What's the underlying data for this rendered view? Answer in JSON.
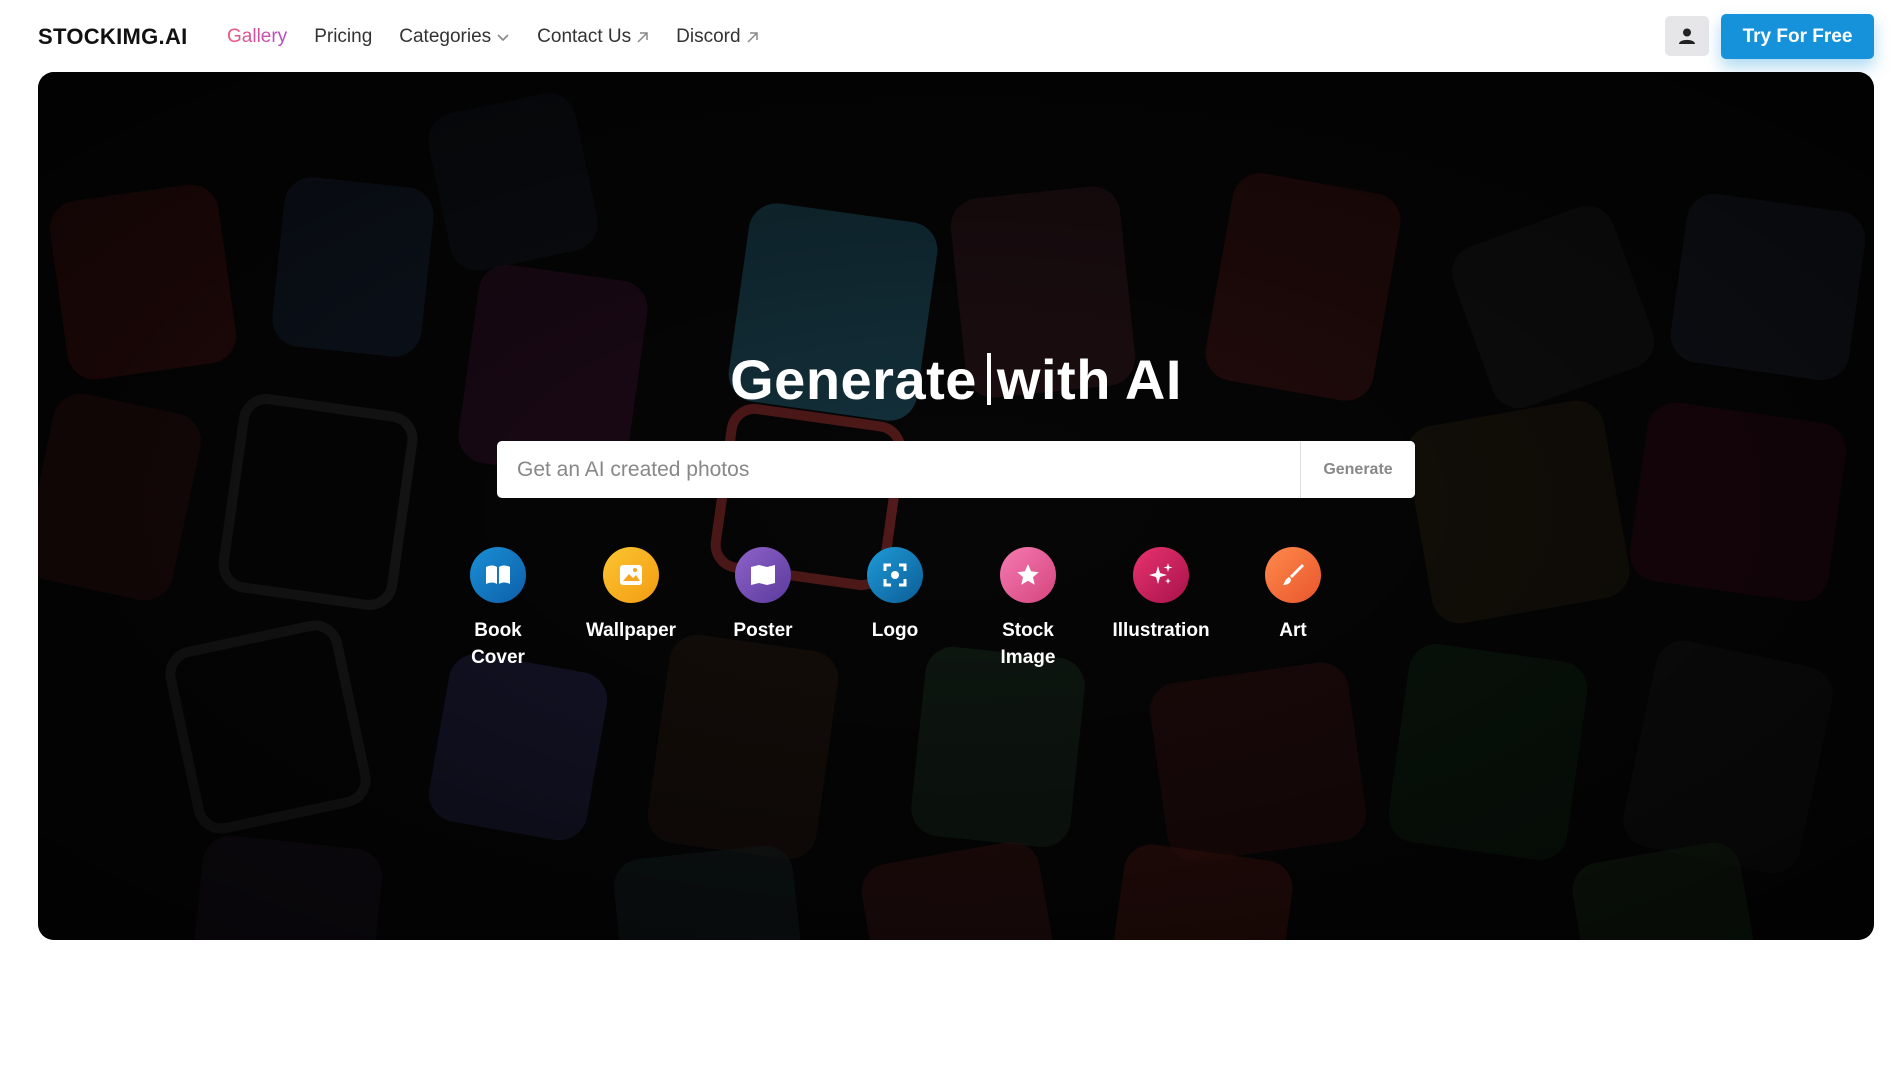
{
  "header": {
    "logo": "STOCKIMG.AI",
    "nav": [
      {
        "label": "Gallery",
        "active": true
      },
      {
        "label": "Pricing"
      },
      {
        "label": "Categories",
        "icon": "chevron-down-icon"
      },
      {
        "label": "Contact Us",
        "icon": "external-link-icon"
      },
      {
        "label": "Discord",
        "icon": "external-link-icon"
      }
    ],
    "user_icon": "user-icon",
    "cta_label": "Try For Free"
  },
  "hero": {
    "headline_prefix": "Generate",
    "headline_suffix": "with AI",
    "search_placeholder": "Get an AI created photos",
    "search_value": "",
    "generate_label": "Generate",
    "categories": [
      {
        "label": "Book Cover",
        "icon": "book-open-icon",
        "colors": [
          "#1a8fd6",
          "#0d5fa8"
        ]
      },
      {
        "label": "Wallpaper",
        "icon": "image-icon",
        "colors": [
          "#fbc531",
          "#f39c12"
        ]
      },
      {
        "label": "Poster",
        "icon": "map-icon",
        "colors": [
          "#8e63c9",
          "#5b3a9c"
        ]
      },
      {
        "label": "Logo",
        "icon": "focus-icon",
        "colors": [
          "#1e9bd7",
          "#0c5d96"
        ]
      },
      {
        "label": "Stock Image",
        "icon": "star-icon",
        "colors": [
          "#f47ab0",
          "#d6457f"
        ]
      },
      {
        "label": "Illustration",
        "icon": "sparkles-icon",
        "colors": [
          "#e8336f",
          "#a8124a"
        ]
      },
      {
        "label": "Art",
        "icon": "brush-icon",
        "colors": [
          "#ff8a4c",
          "#e8552b"
        ]
      }
    ]
  },
  "colors": {
    "accent": "#1592d9",
    "gallery_gradient": [
      "#f0567a",
      "#b34ac9"
    ],
    "hero_bg": "#070707"
  }
}
